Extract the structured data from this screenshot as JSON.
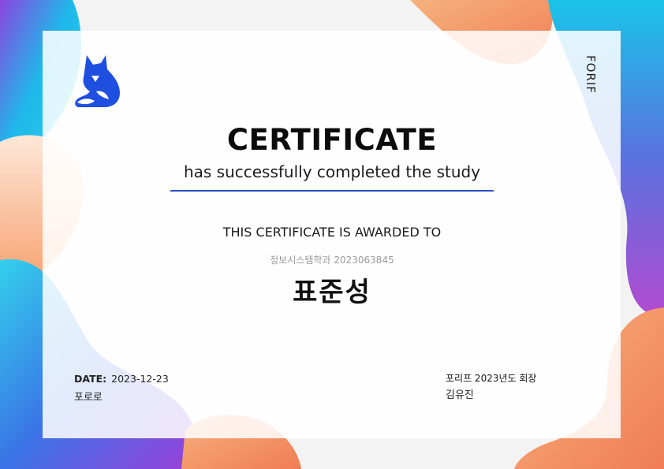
{
  "colors": {
    "accent_blue": "#1f4fe0",
    "rule_blue": "#2a50c8",
    "orange": "#f28c54",
    "peach": "#fde3d3",
    "purple": "#9d4fd6",
    "cyan": "#19c4e8"
  },
  "brand": {
    "logo_icon": "fox-icon",
    "side_label": "FORIF"
  },
  "certificate": {
    "title": "CERTIFICATE",
    "subtitle": "has successfully completed the study",
    "awarded_to": "THIS CERTIFICATE IS AWARDED TO",
    "department_id": "정보시스템학과 2023063845",
    "recipient": "표준성"
  },
  "footer": {
    "date_label": "DATE:",
    "date_value": "2023-12-23",
    "issuer": "포로로",
    "signer_title": "포리프 2023년도 회장",
    "signer_name": "김유진"
  }
}
